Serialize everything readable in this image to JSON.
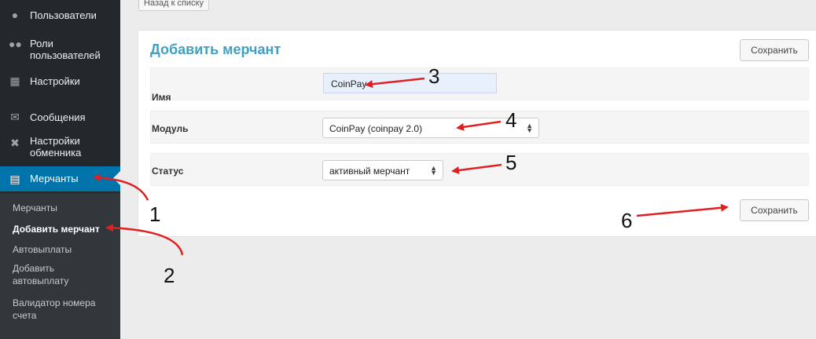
{
  "sidebar": {
    "items": [
      {
        "label": "Пользователи",
        "icon": "user-icon"
      },
      {
        "label": "Роли\nпользователей",
        "icon": "users-icon"
      },
      {
        "label": "Настройки",
        "icon": "settings-icon"
      },
      {
        "label": "Сообщения",
        "icon": "mail-icon"
      },
      {
        "label": "Настройки\nобменника",
        "icon": "tools-icon"
      },
      {
        "label": "Мерчанты",
        "icon": "merchant-icon"
      }
    ],
    "submenu": [
      "Мерчанты",
      "Добавить мерчант",
      "Автовыплаты",
      "Добавить\nавтовыплату",
      "Валидатор номера\nсчета"
    ]
  },
  "top": {
    "back_label": "Назад к списку"
  },
  "form": {
    "title": "Добавить мерчант",
    "save_label": "Сохранить",
    "name_label": "Имя",
    "name_value": "CoinPay",
    "module_label": "Модуль",
    "module_value": "CoinPay (coinpay 2.0)",
    "status_label": "Статус",
    "status_value": "активный мерчант"
  },
  "annotations": {
    "n1": "1",
    "n2": "2",
    "n3": "3",
    "n4": "4",
    "n5": "5",
    "n6": "6"
  },
  "colors": {
    "sidebar": "#23282d",
    "active": "#0073aa",
    "title": "#3fa0c2",
    "arrow": "#e02020"
  }
}
